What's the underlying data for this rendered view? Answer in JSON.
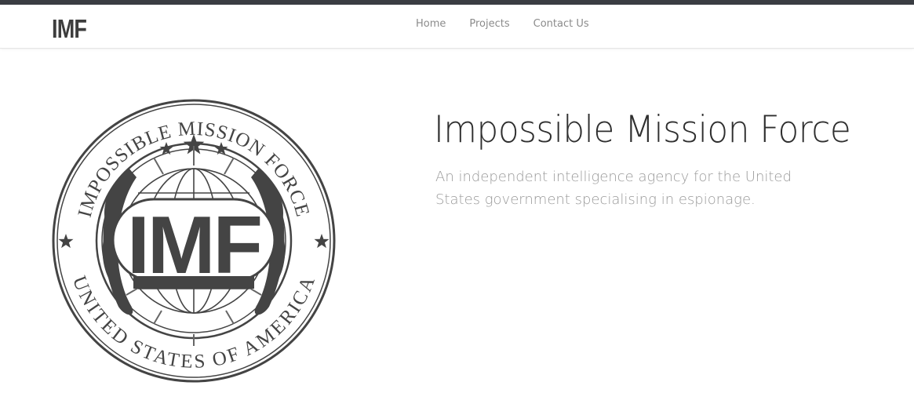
{
  "nav": {
    "brand": "IMF",
    "links": [
      "Home",
      "Projects",
      "Contact Us"
    ]
  },
  "seal": {
    "top_text": "IMPOSSIBLE MISSION FORCE",
    "bottom_text": "UNITED STATES OF AMERICA",
    "center_text": "IMF"
  },
  "hero": {
    "title": "Impossible Mission Force",
    "subtitle": "An independent intelligence agency for the United States government specialising in espionage."
  },
  "colors": {
    "topbar": "#3a3d42",
    "seal": "#444444",
    "title": "#2f2f2f",
    "subtitle": "#9a9a9a",
    "nav_link": "#8b8b8b"
  }
}
